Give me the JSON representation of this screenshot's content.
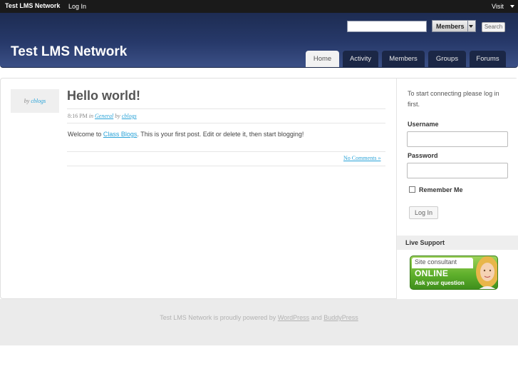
{
  "adminbar": {
    "site_name": "Test LMS Network",
    "login": "Log In",
    "visit": "Visit"
  },
  "header": {
    "site_title": "Test LMS Network",
    "search": {
      "value": "",
      "scope": "Members",
      "button": "Search"
    },
    "nav": [
      {
        "label": "Home",
        "active": true
      },
      {
        "label": "Activity"
      },
      {
        "label": "Members"
      },
      {
        "label": "Groups"
      },
      {
        "label": "Forums"
      }
    ]
  },
  "post": {
    "author_by": "by",
    "author": "cblogs",
    "title": "Hello world!",
    "time": "8:16 PM",
    "in": "in",
    "category": "General",
    "by": "by",
    "author_link": "cblogs",
    "body_prefix": "Welcome to",
    "body_link": "Class Blogs",
    "body_suffix": ". This is your first post. Edit or delete it, then start blogging!",
    "comments": "No Comments »"
  },
  "sidebar": {
    "intro": "To start connecting please log in first.",
    "username_label": "Username",
    "password_label": "Password",
    "remember_label": "Remember Me",
    "login_button": "Log In",
    "live_support_title": "Live Support",
    "banner": {
      "line1": "Site consultant",
      "line2": "ONLINE",
      "line3": "Ask your question"
    }
  },
  "footer": {
    "prefix": "Test LMS Network is proudly powered by",
    "link1": "WordPress",
    "and": "and",
    "link2": "BuddyPress"
  },
  "colors": {
    "header": "#27396a",
    "link": "#2aa3d8",
    "banner_green": "#5fb02c"
  }
}
